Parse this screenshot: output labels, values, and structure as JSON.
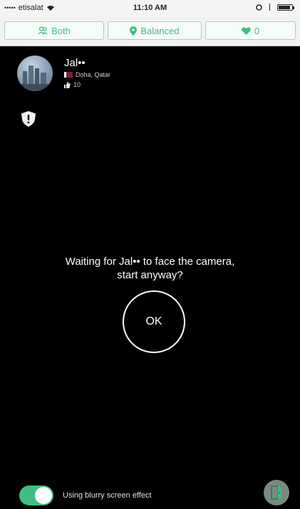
{
  "status_bar": {
    "signal_dots": "•••••",
    "carrier": "etisalat",
    "time": "11:10 AM"
  },
  "filters": {
    "gender_label": "Both",
    "mode_label": "Balanced",
    "hearts_count": "0"
  },
  "profile": {
    "name": "Jal••",
    "location": "Doha, Qatar",
    "likes": "10"
  },
  "dialog": {
    "message_line1": "Waiting for Jal•• to face the camera,",
    "message_line2": "start anyway?",
    "ok_label": "OK"
  },
  "footer": {
    "blur_toggle_on": true,
    "blur_label": "Using blurry screen effect"
  },
  "colors": {
    "accent": "#3fbe83",
    "background": "#000000"
  },
  "icons": {
    "gender": "people-icon",
    "mode": "location-pin-icon",
    "hearts": "heart-icon",
    "report": "shield-alert-icon",
    "exit": "exit-door-icon"
  }
}
